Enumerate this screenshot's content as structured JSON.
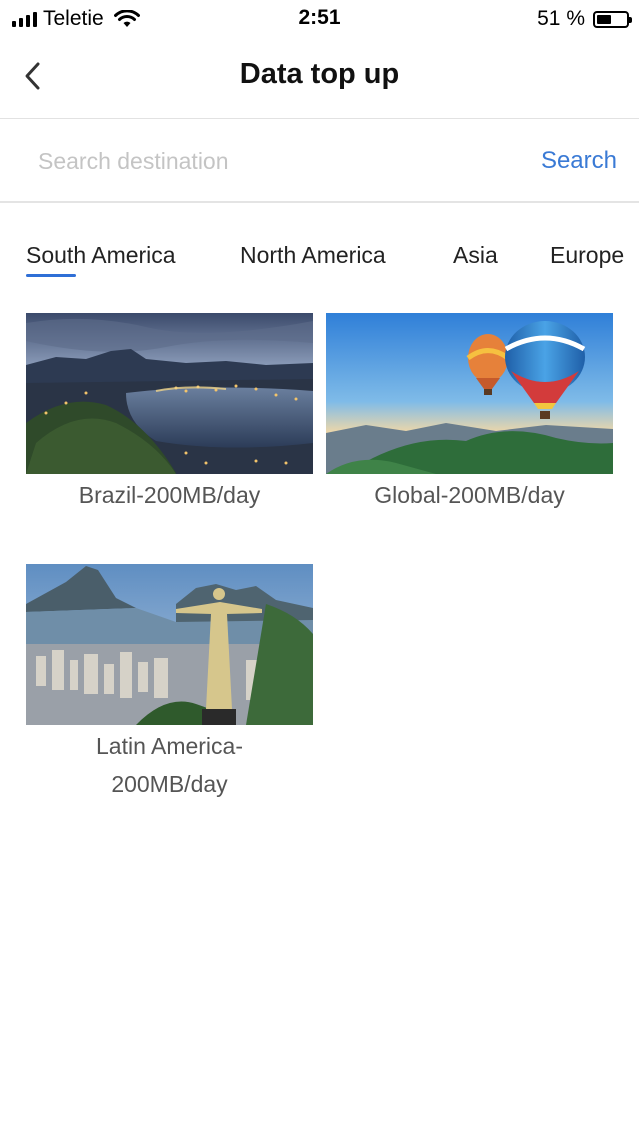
{
  "status_bar": {
    "carrier": "Teletie",
    "time": "2:51",
    "battery_text": "51 %",
    "battery_level": 0.51
  },
  "header": {
    "title": "Data top up",
    "back_icon": "chevron-left-icon"
  },
  "search": {
    "placeholder": "Search destination",
    "value": "",
    "button_label": "Search"
  },
  "tabs": [
    {
      "label": "South America",
      "selected": true
    },
    {
      "label": "North America",
      "selected": false
    },
    {
      "label": "Asia",
      "selected": false
    },
    {
      "label": "Europe",
      "selected": false
    }
  ],
  "colors": {
    "accent": "#3a7ad5",
    "tab_indicator": "#2f6fd6",
    "divider": "#e4e4e4"
  },
  "destinations": [
    {
      "label": "Brazil-200MB/day",
      "image": "rio-night-bay-photo"
    },
    {
      "label": "Global-200MB/day",
      "image": "hot-air-balloons-photo"
    },
    {
      "label": "Latin America-200MB/day",
      "label_line1": "Latin America-",
      "label_line2": "200MB/day",
      "image": "christ-redeemer-photo"
    }
  ]
}
